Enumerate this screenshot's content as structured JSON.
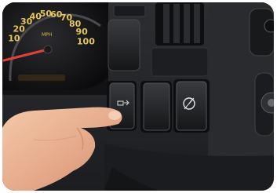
{
  "photo": {
    "speedometer": {
      "numbers": [
        "10",
        "20",
        "30",
        "40",
        "50",
        "60",
        "70",
        "80",
        "90",
        "100"
      ],
      "unit": "MPH"
    },
    "switches": {
      "left_switch_icon": "exhaust-brake-icon",
      "right_switch_icon": "cruise-control-icon",
      "hazard_icon": "hazard-switch"
    },
    "colors": {
      "dash": "#232427",
      "gauge_text": "#e6c65a",
      "needle": "#e0413a",
      "hazard": "#e0523a"
    }
  }
}
